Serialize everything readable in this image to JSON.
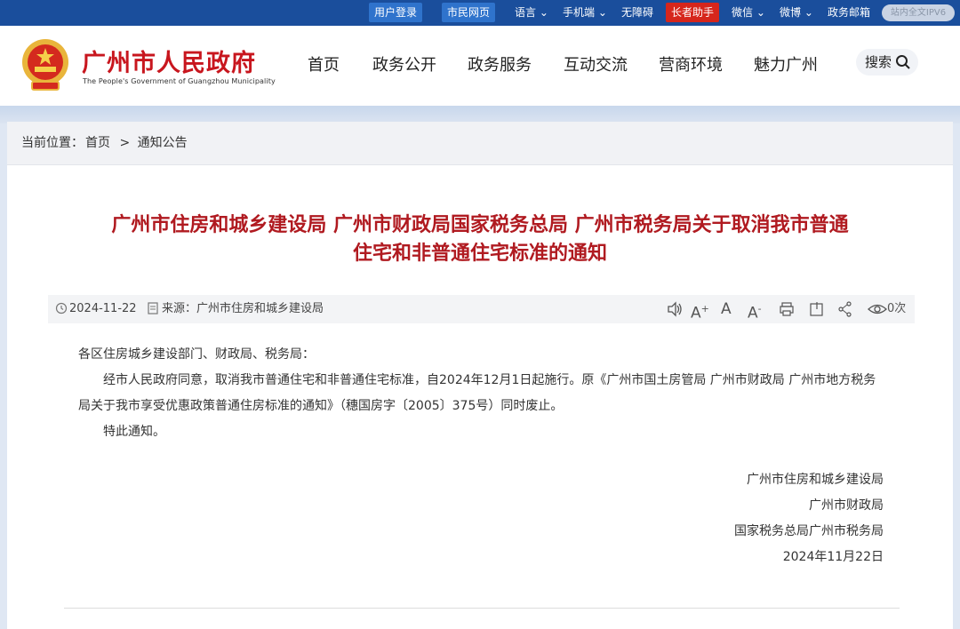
{
  "topbar": {
    "user_login": "用户登录",
    "citizen_page": "市民网页",
    "language": "语言",
    "mobile": "手机端",
    "accessible": "无障碍",
    "elderly": "长者助手",
    "wechat": "微信",
    "weibo": "微博",
    "gov_mail": "政务邮箱",
    "search_placeholder": "站内全文IPV6"
  },
  "header": {
    "site_name": "广州市人民政府",
    "site_name_en": "The People's Government of Guangzhou Municipality",
    "nav": [
      "首页",
      "政务公开",
      "政务服务",
      "互动交流",
      "营商环境",
      "魅力广州"
    ],
    "search_label": "搜索"
  },
  "breadcrumb": {
    "prefix": "当前位置：",
    "home": "首页",
    "sep": ">",
    "current": "通知公告"
  },
  "article": {
    "title_line1": "广州市住房和城乡建设局 广州市财政局国家税务总局 广州市税务局关于取消我市普通",
    "title_line2": "住宅和非普通住宅标准的通知",
    "date": "2024-11-22",
    "source": "来源：广州市住房和城乡建设局",
    "views": "0次",
    "greeting": "各区住房城乡建设部门、财政局、税务局：",
    "para1": "经市人民政府同意，取消我市普通住宅和非普通住宅标准，自2024年12月1日起施行。原《广州市国土房管局 广州市财政局 广州市地方税务局关于我市享受优惠政策普通住房标准的通知》（穗国房字〔2005〕375号）同时废止。",
    "para2": "特此通知。",
    "sign1": "广州市住房和城乡建设局",
    "sign2": "广州市财政局",
    "sign3": "国家税务总局广州市税务局",
    "sign_date": "2024年11月22日"
  },
  "colors": {
    "topbar": "#1a4e9c",
    "brand_red": "#c8161e",
    "title_red": "#b01a20"
  }
}
